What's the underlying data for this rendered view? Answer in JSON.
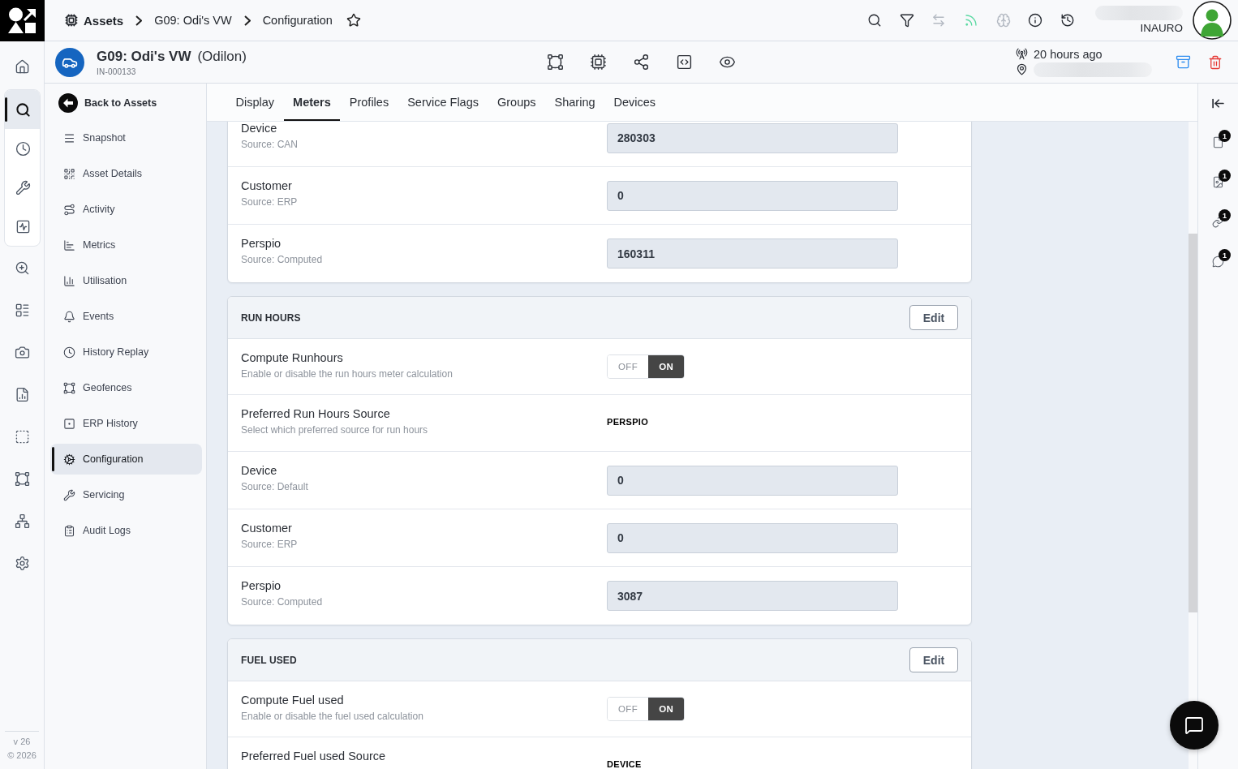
{
  "rail": {
    "top": [
      {
        "selected": false
      }
    ],
    "group": [
      {
        "selected": true
      },
      {
        "selected": false
      },
      {
        "selected": false
      },
      {
        "selected": false
      }
    ],
    "bottom": [
      {
        "selected": false
      },
      {
        "selected": false
      },
      {
        "selected": false
      },
      {
        "selected": false
      },
      {
        "selected": false
      },
      {
        "selected": false
      },
      {
        "selected": false
      },
      {
        "selected": false
      }
    ],
    "version": "v 26",
    "copyright": "© 2026"
  },
  "breadcrumb": {
    "items": [
      "Assets",
      "G09: Odi's VW",
      "Configuration"
    ],
    "starred": false
  },
  "toolbar": [
    {
      "disabled": false
    },
    {
      "disabled": false
    },
    {
      "disabled": true
    },
    {
      "disabled": false,
      "color": "#5cd9a3"
    },
    {
      "disabled": true
    },
    {
      "disabled": false
    },
    {
      "disabled": false
    }
  ],
  "user": {
    "name": "INAURO"
  },
  "asset": {
    "name": "G09: Odi's VW",
    "owner": "(Odilon)",
    "id": "IN-000133",
    "last_seen": "20 hours ago"
  },
  "sidebar": {
    "back": "Back to Assets",
    "items": [
      {
        "label": "Snapshot",
        "selected": false
      },
      {
        "label": "Asset Details",
        "selected": false
      },
      {
        "label": "Activity",
        "selected": false
      },
      {
        "label": "Metrics",
        "selected": false
      },
      {
        "label": "Utilisation",
        "selected": false
      },
      {
        "label": "Events",
        "selected": false
      },
      {
        "label": "History Replay",
        "selected": false
      },
      {
        "label": "Geofences",
        "selected": false
      },
      {
        "label": "ERP History",
        "selected": false
      },
      {
        "label": "Configuration",
        "selected": true
      },
      {
        "label": "Servicing",
        "selected": false
      },
      {
        "label": "Audit Logs",
        "selected": false
      }
    ]
  },
  "tabs": [
    {
      "label": "Display",
      "selected": false
    },
    {
      "label": "Meters",
      "selected": true
    },
    {
      "label": "Profiles",
      "selected": false
    },
    {
      "label": "Service Flags",
      "selected": false
    },
    {
      "label": "Groups",
      "selected": false
    },
    {
      "label": "Sharing",
      "selected": false
    },
    {
      "label": "Devices",
      "selected": false
    }
  ],
  "sections": [
    {
      "rows": [
        {
          "kind": "field",
          "label": "Device",
          "note": "Source: CAN",
          "value": "280303"
        },
        {
          "kind": "field",
          "label": "Customer",
          "note": "Source: ERP",
          "value": "0"
        },
        {
          "kind": "field",
          "label": "Perspio",
          "note": "Source: Computed",
          "value": "160311"
        }
      ]
    },
    {
      "title": "RUN HOURS",
      "edit": "Edit",
      "rows": [
        {
          "kind": "toggle",
          "label": "Compute Runhours",
          "note": "Enable or disable the run hours meter calculation",
          "off_label": "OFF",
          "on_label": "ON",
          "on": true
        },
        {
          "kind": "choice",
          "label": "Preferred Run Hours Source",
          "note": "Select which preferred source for run hours",
          "value": "PERSPIO"
        },
        {
          "kind": "field",
          "label": "Device",
          "note": "Source: Default",
          "value": "0"
        },
        {
          "kind": "field",
          "label": "Customer",
          "note": "Source: ERP",
          "value": "0"
        },
        {
          "kind": "field",
          "label": "Perspio",
          "note": "Source: Computed",
          "value": "3087"
        }
      ]
    },
    {
      "title": "FUEL USED",
      "edit": "Edit",
      "rows": [
        {
          "kind": "toggle",
          "label": "Compute Fuel used",
          "note": "Enable or disable the fuel used calculation",
          "off_label": "OFF",
          "on_label": "ON",
          "on": true
        },
        {
          "kind": "choice",
          "label": "Preferred Fuel used Source",
          "value": "DEVICE"
        }
      ]
    }
  ],
  "right_rail": {
    "items": [
      {
        "badge": "1"
      },
      {
        "badge": "1"
      },
      {
        "badge": "1"
      },
      {
        "badge": "1"
      }
    ]
  }
}
